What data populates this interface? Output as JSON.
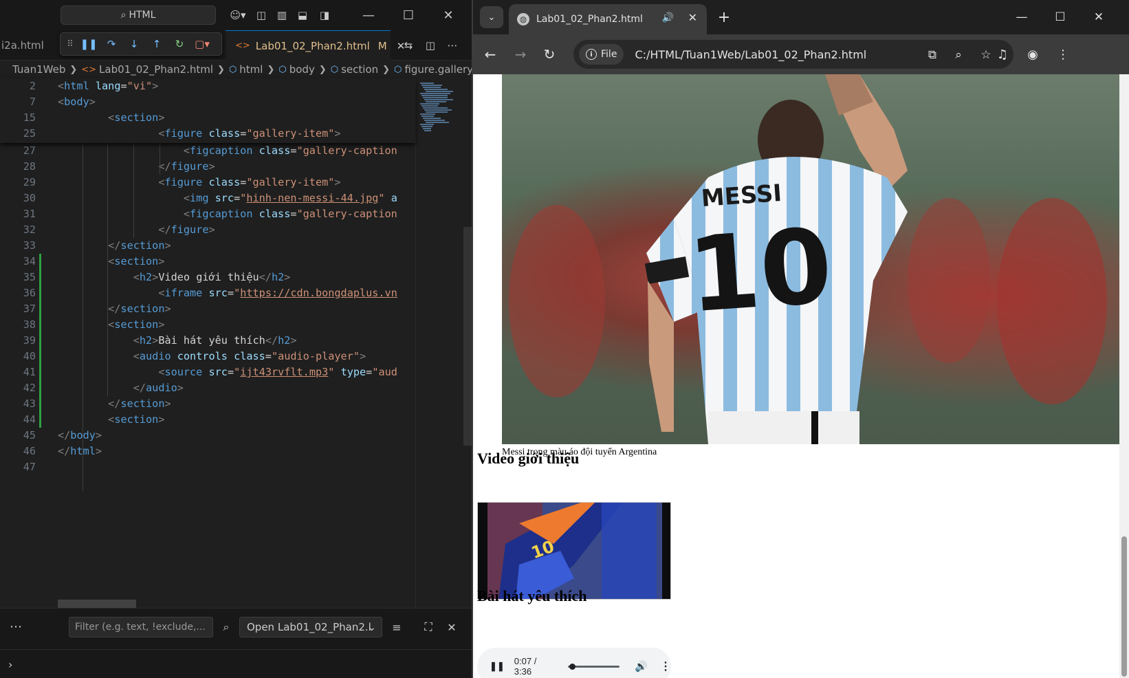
{
  "vscode": {
    "command_center": "HTML",
    "prev_tab": "i2a.html",
    "active_tab": {
      "label": "Lab01_02_Phan2.html",
      "status": "M"
    },
    "breadcrumb": [
      "Tuan1Web",
      "Lab01_02_Phan2.html",
      "html",
      "body",
      "section",
      "figure.gallery"
    ],
    "sticky_lines": [
      {
        "num": "2",
        "html": "<span class=\"t\">&lt;</span><span class=\"tg\">html</span> <span class=\"at\">lang</span><span class=\"tx\">=</span><span class=\"st\">\"vi\"</span><span class=\"t\">&gt;</span>"
      },
      {
        "num": "7",
        "html": "<span class=\"t\">&lt;</span><span class=\"tg\">body</span><span class=\"t\">&gt;</span>"
      },
      {
        "num": "15",
        "html": "        <span class=\"t\">&lt;</span><span class=\"tg\">section</span><span class=\"t\">&gt;</span>"
      },
      {
        "num": "25",
        "html": "                <span class=\"t\">&lt;</span><span class=\"tg\">figure</span> <span class=\"at\">class</span><span class=\"tx\">=</span><span class=\"st\">\"gallery-item\"</span><span class=\"t\">&gt;</span>"
      }
    ],
    "code_lines": [
      {
        "num": "27",
        "html": "                    <span class=\"t\">&lt;</span><span class=\"tg\">figcaption</span> <span class=\"at\">class</span><span class=\"tx\">=</span><span class=\"st\">\"gallery-caption</span>"
      },
      {
        "num": "28",
        "html": "                <span class=\"t\">&lt;/</span><span class=\"tg\">figure</span><span class=\"t\">&gt;</span>"
      },
      {
        "num": "29",
        "html": "                <span class=\"t\">&lt;</span><span class=\"tg\">figure</span> <span class=\"at\">class</span><span class=\"tx\">=</span><span class=\"st\">\"gallery-item\"</span><span class=\"t\">&gt;</span>"
      },
      {
        "num": "30",
        "html": "                    <span class=\"t\">&lt;</span><span class=\"tg\">img</span> <span class=\"at\">src</span><span class=\"tx\">=</span><span class=\"st\">\"<span class=\"lnk\">hinh-nen-messi-44.jpg</span>\"</span> <span class=\"at\">a</span>"
      },
      {
        "num": "31",
        "html": "                    <span class=\"t\">&lt;</span><span class=\"tg\">figcaption</span> <span class=\"at\">class</span><span class=\"tx\">=</span><span class=\"st\">\"gallery-caption</span>"
      },
      {
        "num": "32",
        "html": "                <span class=\"t\">&lt;/</span><span class=\"tg\">figure</span><span class=\"t\">&gt;</span>"
      },
      {
        "num": "33",
        "html": "        <span class=\"t\">&lt;/</span><span class=\"tg\">section</span><span class=\"t\">&gt;</span>"
      },
      {
        "num": "34",
        "html": "        <span class=\"t\">&lt;</span><span class=\"tg\">section</span><span class=\"t\">&gt;</span>"
      },
      {
        "num": "35",
        "html": "            <span class=\"t\">&lt;</span><span class=\"tg\">h2</span><span class=\"t\">&gt;</span><span class=\"tx\">Video giới thiệu</span><span class=\"t\">&lt;/</span><span class=\"tg\">h2</span><span class=\"t\">&gt;</span>"
      },
      {
        "num": "36",
        "html": "                <span class=\"t\">&lt;</span><span class=\"tg\">iframe</span> <span class=\"at\">src</span><span class=\"tx\">=</span><span class=\"st\">\"<span class=\"lnk\">https://cdn.bongdaplus.vn</span></span>"
      },
      {
        "num": "37",
        "html": "        <span class=\"t\">&lt;/</span><span class=\"tg\">section</span><span class=\"t\">&gt;</span>"
      },
      {
        "num": "38",
        "html": "        <span class=\"t\">&lt;</span><span class=\"tg\">section</span><span class=\"t\">&gt;</span>"
      },
      {
        "num": "39",
        "html": "            <span class=\"t\">&lt;</span><span class=\"tg\">h2</span><span class=\"t\">&gt;</span><span class=\"tx\">Bài hát yêu thích</span><span class=\"t\">&lt;/</span><span class=\"tg\">h2</span><span class=\"t\">&gt;</span>"
      },
      {
        "num": "40",
        "html": "            <span class=\"t\">&lt;</span><span class=\"tg\">audio</span> <span class=\"at\">controls</span> <span class=\"at\">class</span><span class=\"tx\">=</span><span class=\"st\">\"audio-player\"</span><span class=\"t\">&gt;</span>"
      },
      {
        "num": "41",
        "html": "                <span class=\"t\">&lt;</span><span class=\"tg\">source</span> <span class=\"at\">src</span><span class=\"tx\">=</span><span class=\"st\">\"<span class=\"lnk\">ijt43rvflt.mp3</span>\"</span> <span class=\"at\">type</span><span class=\"tx\">=</span><span class=\"st\">\"aud</span>"
      },
      {
        "num": "42",
        "html": "            <span class=\"t\">&lt;/</span><span class=\"tg\">audio</span><span class=\"t\">&gt;</span>"
      },
      {
        "num": "43",
        "html": "        <span class=\"t\">&lt;/</span><span class=\"tg\">section</span><span class=\"t\">&gt;</span>"
      },
      {
        "num": "44",
        "html": "        <span class=\"t\">&lt;</span><span class=\"tg\">section</span><span class=\"t\">&gt;</span>"
      },
      {
        "num": "45",
        "html": "<span class=\"t\">&lt;/</span><span class=\"tg\">body</span><span class=\"t\">&gt;</span>"
      },
      {
        "num": "46",
        "html": "<span class=\"t\">&lt;/</span><span class=\"tg\">html</span><span class=\"t\">&gt;</span>"
      },
      {
        "num": "47",
        "html": ""
      }
    ],
    "find": {
      "placeholder": "Filter (e.g. text, !exclude,...",
      "select_value": "Open Lab01_02_Phan2.l"
    }
  },
  "chrome": {
    "tab_title": "Lab01_02_Phan2.html",
    "omnibox": {
      "chip": "File",
      "url": "C:/HTML/Tuan1Web/Lab01_02_Phan2.html"
    },
    "page": {
      "image_jersey_name": "MESSI",
      "image_jersey_number": "10",
      "caption": "Messi trong màu áo đội tuyển Argentina",
      "video_heading": "Video giới thiệu",
      "video_jersey_number": "10",
      "song_heading": "Bài hát yêu thích",
      "audio": {
        "current": "0:07",
        "duration": "3:36",
        "progress": 0.032
      }
    }
  }
}
